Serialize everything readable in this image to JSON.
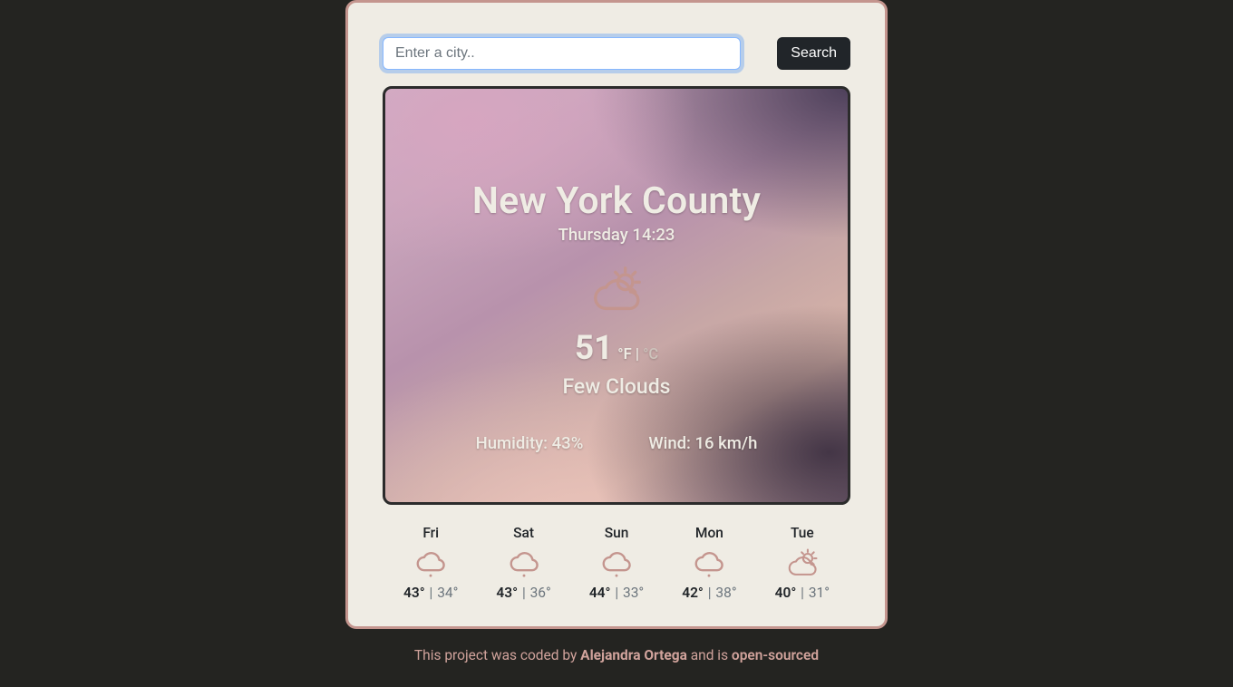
{
  "search": {
    "placeholder": "Enter a city..",
    "button": "Search"
  },
  "current": {
    "city": "New York County",
    "datetime": "Thursday 14:23",
    "icon": "partly-cloudy",
    "temp": "51",
    "unit_f": "°F",
    "unit_sep": " | ",
    "unit_c": "°C",
    "description": "Few Clouds",
    "humidity_label": "Humidity: ",
    "humidity_value": "43%",
    "wind_label": "Wind: ",
    "wind_value": "16 km/h"
  },
  "forecast": [
    {
      "day": "Fri",
      "icon": "rain",
      "hi": "43°",
      "lo": "34°"
    },
    {
      "day": "Sat",
      "icon": "rain",
      "hi": "43°",
      "lo": "36°"
    },
    {
      "day": "Sun",
      "icon": "rain",
      "hi": "44°",
      "lo": "33°"
    },
    {
      "day": "Mon",
      "icon": "rain",
      "hi": "42°",
      "lo": "38°"
    },
    {
      "day": "Tue",
      "icon": "partly-cloudy",
      "hi": "40°",
      "lo": "31°"
    }
  ],
  "footer": {
    "pre": "This project was coded by ",
    "author": "Alejandra Ortega",
    "mid": " and is ",
    "os": "open-sourced"
  },
  "colors": {
    "icon_pink": "#c4958e"
  }
}
